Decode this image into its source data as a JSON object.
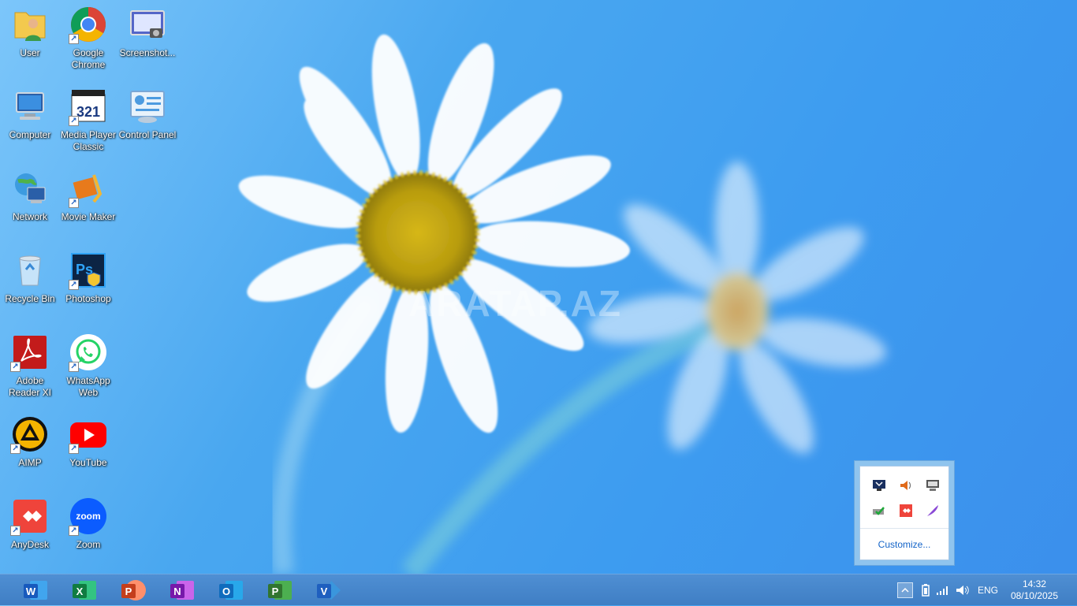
{
  "watermark": "ARATAP.AZ",
  "desktop_icons": [
    {
      "label": "User"
    },
    {
      "label": "Google Chrome"
    },
    {
      "label": "Screenshot..."
    },
    {
      "label": "Computer"
    },
    {
      "label": "Media Player Classic"
    },
    {
      "label": "Control Panel"
    },
    {
      "label": "Network"
    },
    {
      "label": "Movie Maker"
    },
    {
      "label": "Recycle Bin"
    },
    {
      "label": "Photoshop"
    },
    {
      "label": "Adobe Reader XI"
    },
    {
      "label": "WhatsApp Web"
    },
    {
      "label": "AIMP"
    },
    {
      "label": "YouTube"
    },
    {
      "label": "AnyDesk"
    },
    {
      "label": "Zoom"
    }
  ],
  "tray_popup": {
    "customize_label": "Customize..."
  },
  "taskbar": {
    "apps": [
      {
        "letter": "W",
        "color": "#185abd"
      },
      {
        "letter": "X",
        "color": "#107c41"
      },
      {
        "letter": "P",
        "color": "#c43e1c"
      },
      {
        "letter": "N",
        "color": "#7719aa"
      },
      {
        "letter": "O",
        "color": "#0f6cbd"
      },
      {
        "letter": "P",
        "color": "#31752f"
      },
      {
        "letter": "V",
        "color": "#1f5fbf"
      }
    ],
    "language": "ENG",
    "time": "14:32",
    "date": "08/10/2025"
  },
  "colors": {
    "accent": "#3d9cf0",
    "taskbar": "#4583c8"
  }
}
